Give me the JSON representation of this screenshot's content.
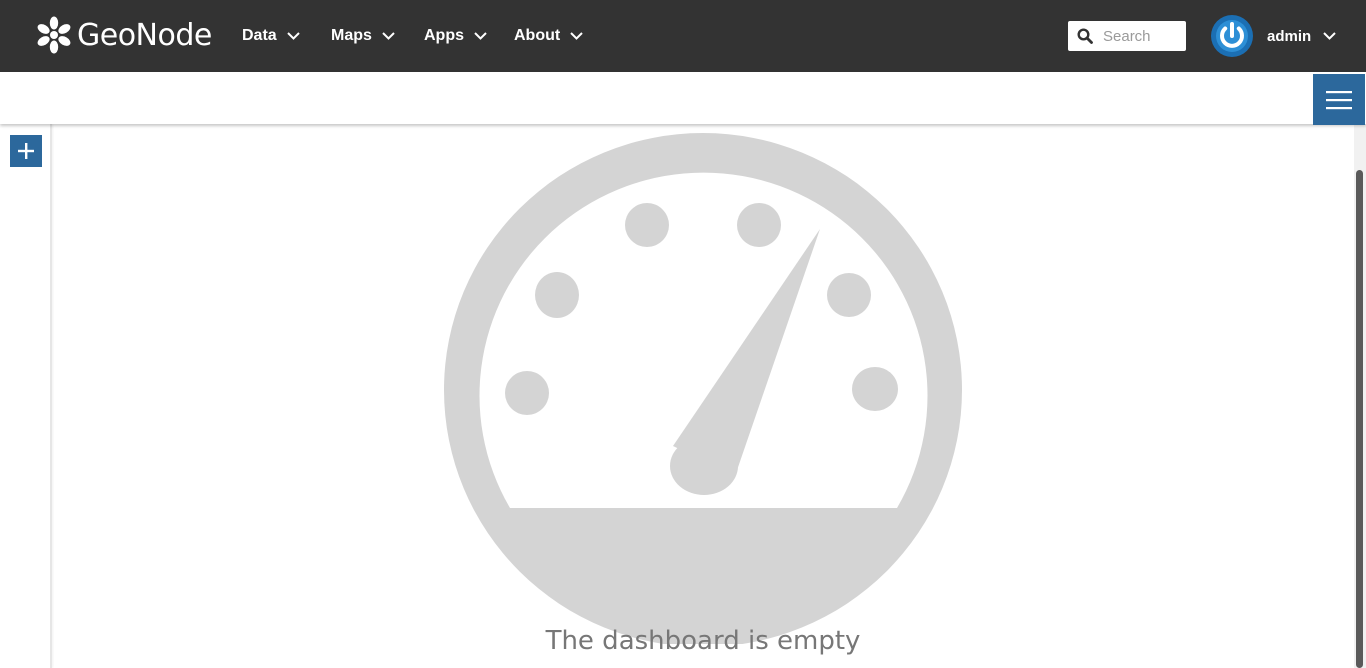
{
  "navbar": {
    "brand": "GeoNode",
    "menus": [
      {
        "label": "Data"
      },
      {
        "label": "Maps"
      },
      {
        "label": "Apps"
      },
      {
        "label": "About"
      }
    ],
    "search": {
      "placeholder": "Search",
      "value": ""
    },
    "user": {
      "name": "admin"
    },
    "colors": {
      "background": "#333333",
      "text": "#ffffff"
    }
  },
  "toolbar": {
    "menu_icon": "hamburger-icon",
    "accent": "#2c689c"
  },
  "side_panel": {
    "add_icon": "plus-icon"
  },
  "dashboard": {
    "empty_icon": "dashboard-gauge-icon",
    "empty_message": "The dashboard is empty",
    "icon_color": "#d4d4d4"
  }
}
